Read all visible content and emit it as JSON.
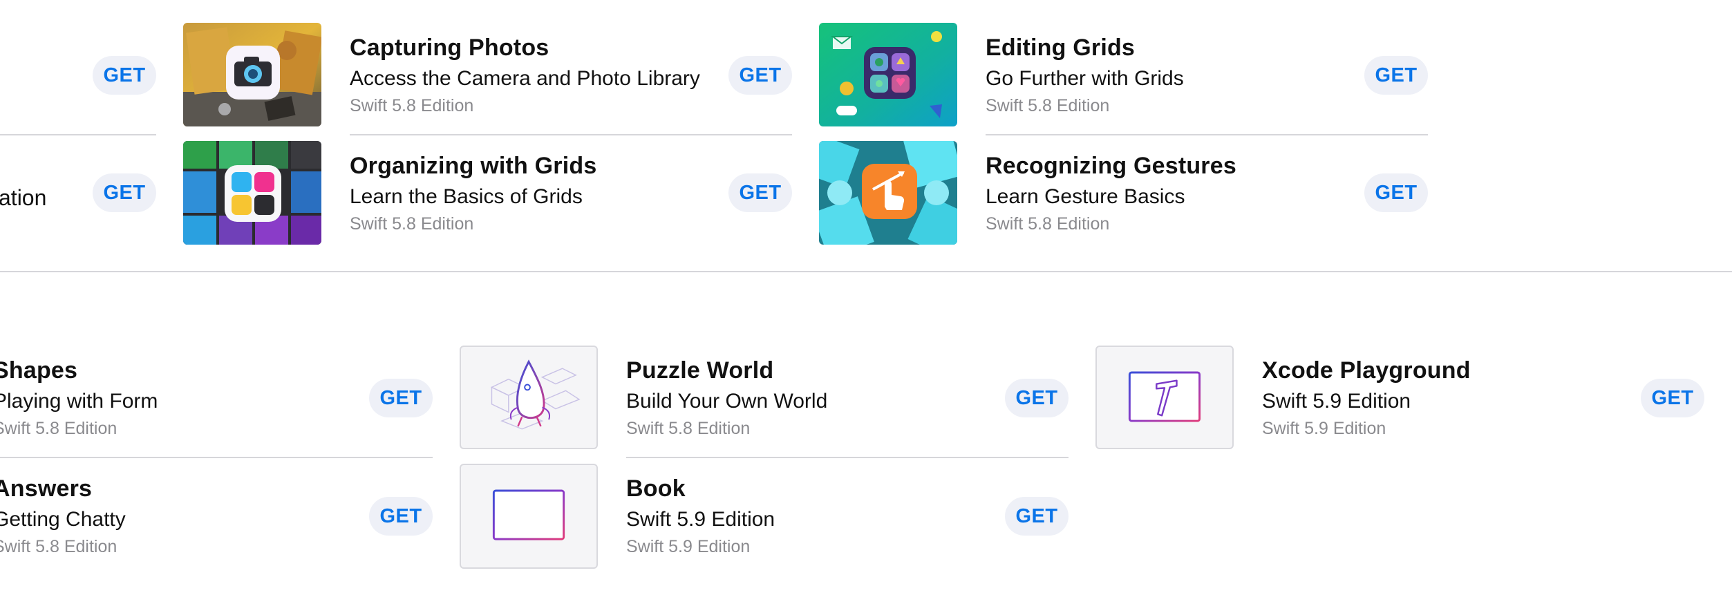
{
  "section1": {
    "left_partial": {
      "row2_title_tail": "ation",
      "get_label": "GET"
    },
    "items": [
      {
        "title": "Capturing Photos",
        "subtitle": "Access the Camera and Photo Library",
        "edition": "Swift 5.8 Edition",
        "get_label": "GET",
        "icon": "camera-icon"
      },
      {
        "title": "Organizing with Grids",
        "subtitle": "Learn the Basics of Grids",
        "edition": "Swift 5.8 Edition",
        "get_label": "GET",
        "icon": "grid-icon"
      },
      {
        "title": "Editing Grids",
        "subtitle": "Go Further with Grids",
        "edition": "Swift 5.8 Edition",
        "get_label": "GET",
        "icon": "grid-editor-icon"
      },
      {
        "title": "Recognizing Gestures",
        "subtitle": "Learn Gesture Basics",
        "edition": "Swift 5.8 Edition",
        "get_label": "GET",
        "icon": "hand-gesture-icon"
      }
    ]
  },
  "section2": {
    "items": [
      {
        "title": "Shapes",
        "subtitle": "Playing with Form",
        "edition": "Swift 5.8 Edition",
        "get_label": "GET"
      },
      {
        "title": "Answers",
        "subtitle": "Getting Chatty",
        "edition": "Swift 5.8 Edition",
        "get_label": "GET"
      },
      {
        "title": "Puzzle World",
        "subtitle": "Build Your Own World",
        "edition": "Swift 5.8 Edition",
        "get_label": "GET",
        "icon": "puzzle-character-icon"
      },
      {
        "title": "Book",
        "subtitle": "Swift 5.9 Edition",
        "edition": "Swift 5.9 Edition",
        "get_label": "GET",
        "icon": "book-frame-icon"
      },
      {
        "title": "Xcode Playground",
        "subtitle": "Swift 5.9 Edition",
        "edition": "Swift 5.9 Edition",
        "get_label": "GET",
        "icon": "hammer-icon"
      }
    ]
  }
}
